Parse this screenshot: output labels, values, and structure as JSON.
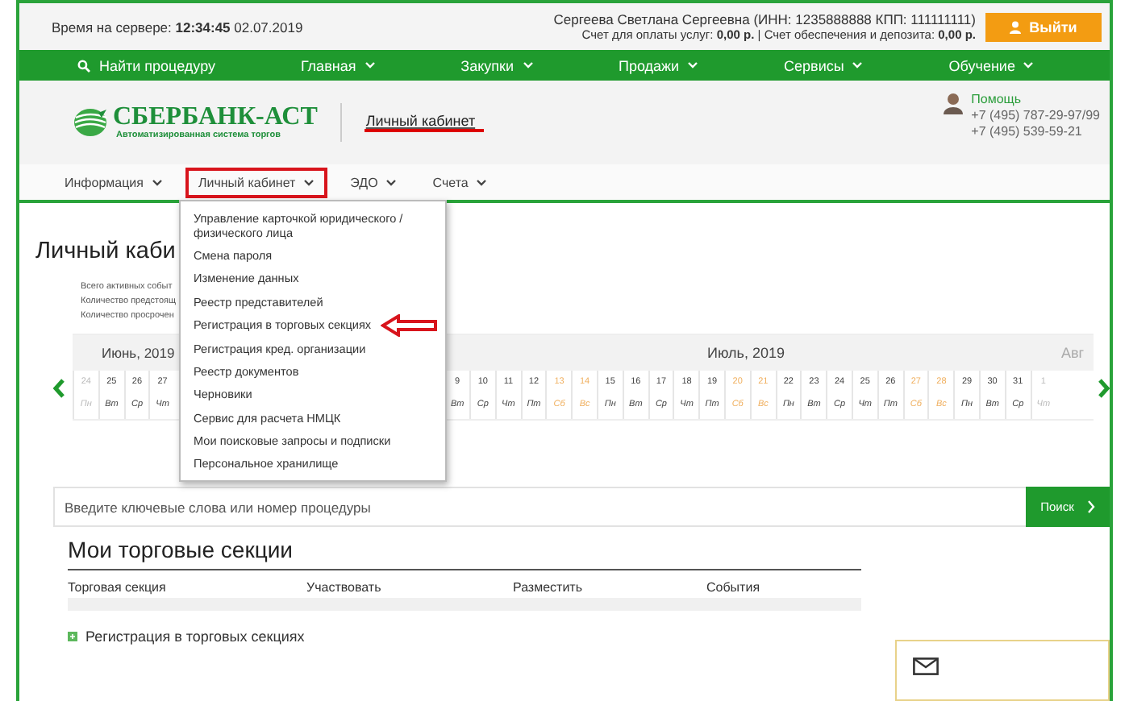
{
  "server_time": {
    "label": "Время на сервере:",
    "time": "12:34:45",
    "date": "02.07.2019"
  },
  "user": {
    "name": "Сергеева Светлана Сергеевна (ИНН: 1235888888 КПП: 111111111)",
    "accounts": "Счет для оплаты услуг: **0,00 р.** | Счет обеспечения и депозита: **0,00 р.**"
  },
  "logout_button": "Выйти",
  "main_nav": [
    {
      "label": "Найти процедуру",
      "kind": "search"
    },
    {
      "label": "Главная",
      "kind": "menu"
    },
    {
      "label": "Закупки",
      "kind": "menu"
    },
    {
      "label": "Продажи",
      "kind": "menu"
    },
    {
      "label": "Сервисы",
      "kind": "menu"
    },
    {
      "label": "Обучение",
      "kind": "menu"
    }
  ],
  "logo": {
    "name": "СБЕРБАНК-АСТ",
    "tagline": "Автоматизированная система торгов"
  },
  "cabinet_link": {
    "label": "Личный кабинет",
    "underlined": true
  },
  "help": {
    "label": "Помощь",
    "phones": [
      "+7 (495) 787-29-97/99",
      "+7 (495) 539-59-21"
    ]
  },
  "sub_nav": [
    {
      "label": "Информация",
      "highlighted": false
    },
    {
      "label": "Личный кабинет",
      "highlighted": true
    },
    {
      "label": "ЭДО",
      "highlighted": false
    },
    {
      "label": "Счета",
      "highlighted": false
    }
  ],
  "dropdown": [
    {
      "label": "Управление карточкой юридического / физического лица",
      "marked": false
    },
    {
      "label": "Смена пароля",
      "marked": false
    },
    {
      "label": "Изменение данных",
      "marked": false
    },
    {
      "label": "Реестр представителей",
      "marked": false
    },
    {
      "label": "Регистрация в торговых секциях",
      "marked": true
    },
    {
      "label": "Регистрация кред. организации",
      "marked": false
    },
    {
      "label": "Реестр документов",
      "marked": false
    },
    {
      "label": "Черновики",
      "marked": false
    },
    {
      "label": "Сервис для расчета НМЦК",
      "marked": false
    },
    {
      "label": "Мои поисковые запросы и подписки",
      "marked": false
    },
    {
      "label": "Персональное хранилище",
      "marked": false
    }
  ],
  "page_title": "Личный каби",
  "stats": [
    "Всего активных событ",
    "Количество предстоящ",
    "Количество просрочен"
  ],
  "calendar": {
    "months": [
      "Июнь, 2019",
      "Июль, 2019",
      "Авг"
    ],
    "days_left": [
      {
        "day": "24",
        "weekday": "Пн",
        "weekend": false,
        "outside": true
      },
      {
        "day": "25",
        "weekday": "Вт",
        "weekend": false,
        "outside": false
      },
      {
        "day": "26",
        "weekday": "Ср",
        "weekend": false,
        "outside": false
      },
      {
        "day": "27",
        "weekday": "Чт",
        "weekend": false,
        "outside": false
      }
    ],
    "days_right": [
      {
        "day": "9",
        "weekday": "Вт",
        "weekend": false,
        "outside": false
      },
      {
        "day": "10",
        "weekday": "Ср",
        "weekend": false,
        "outside": false
      },
      {
        "day": "11",
        "weekday": "Чт",
        "weekend": false,
        "outside": false
      },
      {
        "day": "12",
        "weekday": "Пт",
        "weekend": false,
        "outside": false
      },
      {
        "day": "13",
        "weekday": "Сб",
        "weekend": true,
        "outside": false
      },
      {
        "day": "14",
        "weekday": "Вс",
        "weekend": true,
        "outside": false
      },
      {
        "day": "15",
        "weekday": "Пн",
        "weekend": false,
        "outside": false
      },
      {
        "day": "16",
        "weekday": "Вт",
        "weekend": false,
        "outside": false
      },
      {
        "day": "17",
        "weekday": "Ср",
        "weekend": false,
        "outside": false
      },
      {
        "day": "18",
        "weekday": "Чт",
        "weekend": false,
        "outside": false
      },
      {
        "day": "19",
        "weekday": "Пт",
        "weekend": false,
        "outside": false
      },
      {
        "day": "20",
        "weekday": "Сб",
        "weekend": true,
        "outside": false
      },
      {
        "day": "21",
        "weekday": "Вс",
        "weekend": true,
        "outside": false
      },
      {
        "day": "22",
        "weekday": "Пн",
        "weekend": false,
        "outside": false
      },
      {
        "day": "23",
        "weekday": "Вт",
        "weekend": false,
        "outside": false
      },
      {
        "day": "24",
        "weekday": "Ср",
        "weekend": false,
        "outside": false
      },
      {
        "day": "25",
        "weekday": "Чт",
        "weekend": false,
        "outside": false
      },
      {
        "day": "26",
        "weekday": "Пт",
        "weekend": false,
        "outside": false
      },
      {
        "day": "27",
        "weekday": "Сб",
        "weekend": true,
        "outside": false
      },
      {
        "day": "28",
        "weekday": "Вс",
        "weekend": true,
        "outside": false
      },
      {
        "day": "29",
        "weekday": "Пн",
        "weekend": false,
        "outside": false
      },
      {
        "day": "30",
        "weekday": "Вт",
        "weekend": false,
        "outside": false
      },
      {
        "day": "31",
        "weekday": "Ср",
        "weekend": false,
        "outside": false
      },
      {
        "day": "1",
        "weekday": "Чт",
        "weekend": false,
        "outside": true
      }
    ]
  },
  "search": {
    "placeholder": "Введите ключевые слова или номер процедуры",
    "button": "Поиск"
  },
  "sections": {
    "title": "Мои торговые секции",
    "columns": [
      "Торговая секция",
      "Участвовать",
      "Разместить",
      "События"
    ],
    "link": "Регистрация в торговых секциях"
  }
}
